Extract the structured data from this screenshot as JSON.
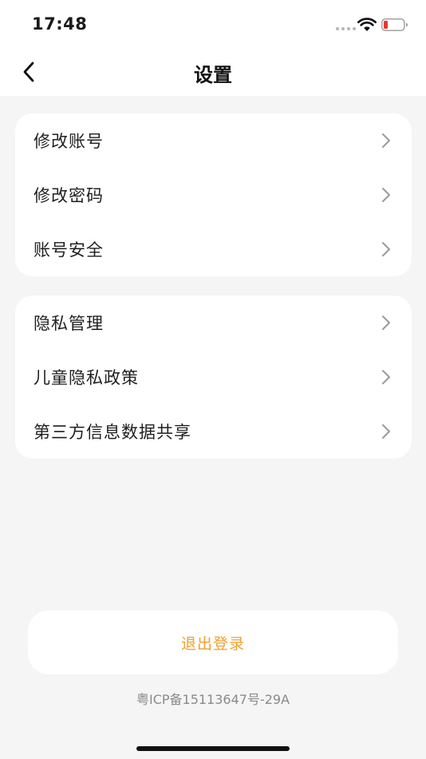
{
  "status_bar": {
    "time": "17:48",
    "battery_color": "#e53935"
  },
  "nav": {
    "title": "设置",
    "back_icon": "chevron-left-icon"
  },
  "groups": [
    {
      "items": [
        {
          "label": "修改账号"
        },
        {
          "label": "修改密码"
        },
        {
          "label": "账号安全"
        }
      ]
    },
    {
      "items": [
        {
          "label": "隐私管理"
        },
        {
          "label": "儿童隐私政策"
        },
        {
          "label": "第三方信息数据共享"
        }
      ]
    }
  ],
  "logout": {
    "label": "退出登录",
    "color": "#f0a030"
  },
  "footer": {
    "icp": "粤ICP备15113647号-29A"
  }
}
